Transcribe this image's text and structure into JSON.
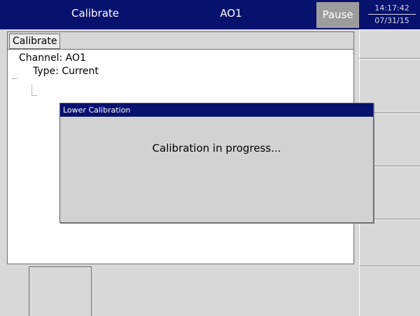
{
  "header": {
    "title": "Calibrate",
    "channel": "AO1",
    "pause_label": "Pause",
    "time": "14:17:42",
    "date": "07/31/15"
  },
  "panel": {
    "tab_label": "Calibrate",
    "tree": {
      "channel": "Channel: AO1",
      "type": "Type: Current"
    }
  },
  "dialog": {
    "title": "Lower Calibration",
    "message": "Calibration in progress..."
  },
  "colors": {
    "titlebar": "#07116e",
    "background": "#d8d8d8",
    "pause_button": "#9c9c9c"
  }
}
